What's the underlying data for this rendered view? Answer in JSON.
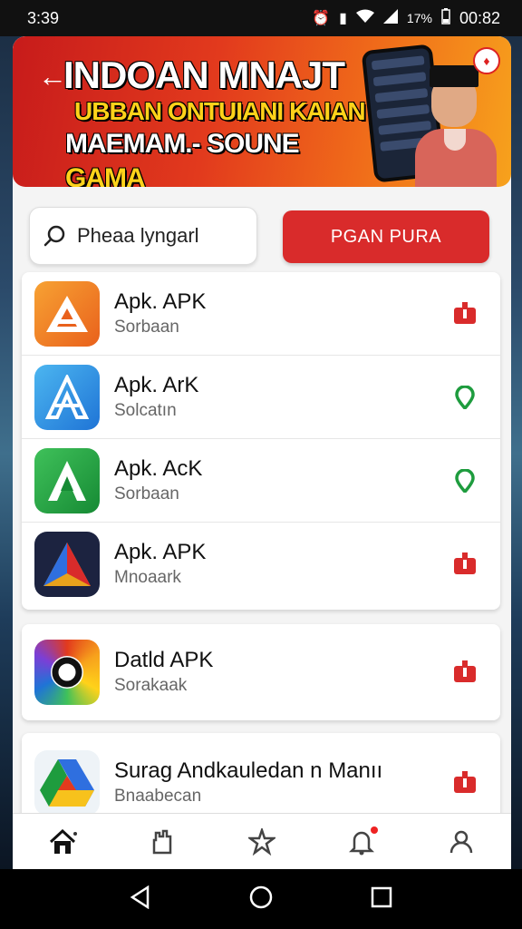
{
  "status_bar": {
    "time": "3:39",
    "battery_percent": "17%",
    "clock_right": "00:82"
  },
  "banner": {
    "line1": "INDOAN MNAJT",
    "line2": "UBBAN ONTUIANI KAIAN",
    "line3_prefix": "MAEMAM.- SOUNE",
    "line3_highlight": "GAMA"
  },
  "search": {
    "text": "Pheaa lyngarl"
  },
  "primary_button": {
    "label": "PGAN PURA"
  },
  "apps": [
    {
      "title": "Apk. APK",
      "subtitle": "Sorbaan",
      "icon": "orange-a-logo-icon",
      "action": "red-download-icon"
    },
    {
      "title": "Apk. ArK",
      "subtitle": "Solcatın",
      "icon": "blue-a-logo-icon",
      "action": "green-location-icon"
    },
    {
      "title": "Apk. AcK",
      "subtitle": "Sorbaan",
      "icon": "green-a-logo-icon",
      "action": "green-location-icon"
    },
    {
      "title": "Apk. APK",
      "subtitle": "Mnoaark",
      "icon": "navy-triangle-logo-icon",
      "action": "red-download-icon"
    },
    {
      "title": "Datld APK",
      "subtitle": "Sorakaak",
      "icon": "colorful-ring-logo-icon",
      "action": "red-download-icon"
    },
    {
      "title": "Surag Andkauledan n Manıı",
      "subtitle": "Bnaabecan",
      "icon": "drive-logo-icon",
      "action": "red-download-icon"
    }
  ],
  "bottom_nav": [
    "home-icon",
    "hand-icon",
    "star-icon",
    "bell-icon",
    "profile-icon"
  ],
  "colors": {
    "accent": "#d92b2b",
    "green_action": "#1e9c3e",
    "banner_start": "#c71b1b",
    "banner_end": "#f7a21c"
  }
}
